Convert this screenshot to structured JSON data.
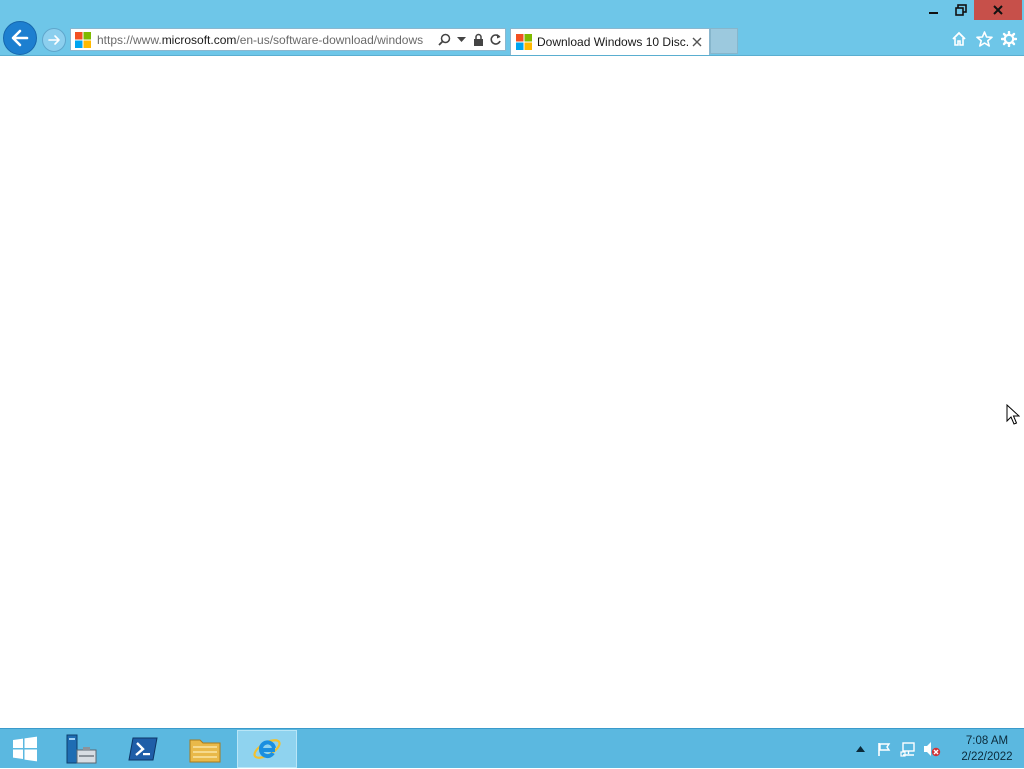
{
  "window": {
    "controls": [
      "minimize",
      "restore",
      "close"
    ]
  },
  "browser": {
    "address": {
      "url_prefix": "https://www.",
      "url_domain": "microsoft.com",
      "url_path": "/en-us/software-download/windows"
    },
    "tab": {
      "title": "Download Windows 10 Disc..."
    },
    "toolbar_icons": [
      "home-icon",
      "favorites-star-icon",
      "settings-gear-icon"
    ]
  },
  "taskbar": {
    "apps": [
      "start",
      "server-manager",
      "powershell",
      "file-explorer",
      "internet-explorer"
    ],
    "active_app": "internet-explorer",
    "clock": {
      "time": "7:08 AM",
      "date": "2/22/2022"
    }
  },
  "colors": {
    "titlebar": "#6ec6e8",
    "taskbar": "#5bb8e0",
    "close_button": "#c7504a",
    "back_button": "#1d7fd0"
  }
}
